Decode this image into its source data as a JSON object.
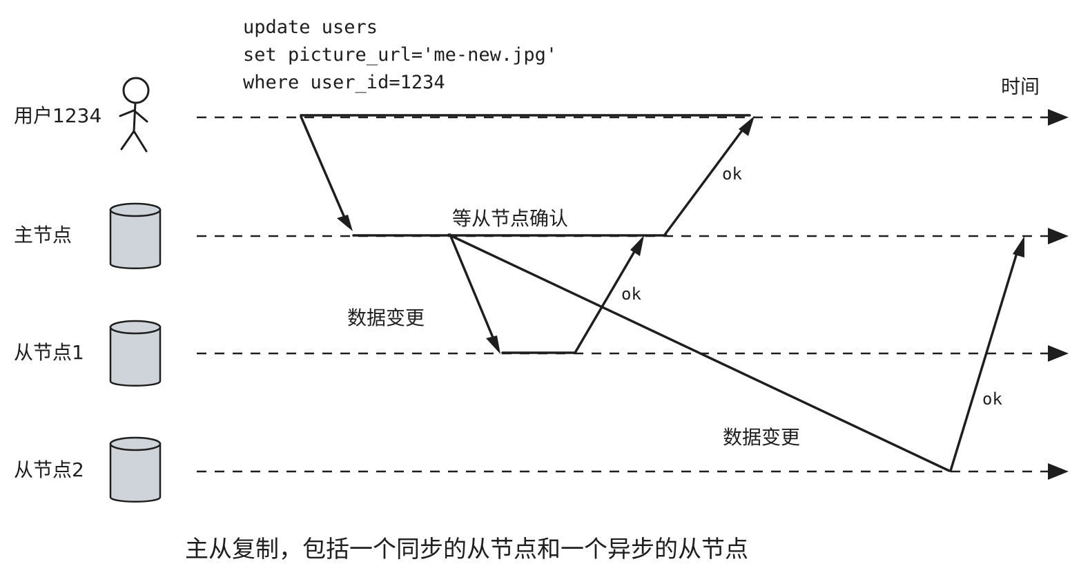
{
  "diagram": {
    "lanes": [
      {
        "id": "user",
        "label": "用户1234",
        "icon": "stick-figure-icon"
      },
      {
        "id": "primary",
        "label": "主节点",
        "icon": "database-cylinder-icon"
      },
      {
        "id": "follower1",
        "label": "从节点1",
        "icon": "database-cylinder-icon"
      },
      {
        "id": "follower2",
        "label": "从节点2",
        "icon": "database-cylinder-icon"
      }
    ],
    "time_label": "时间",
    "sql": {
      "line1": "update users",
      "line2": "set picture_url='me-new.jpg'",
      "line3": "where user_id=1234"
    },
    "wait_label": "等从节点确认",
    "change_label_1": "数据变更",
    "change_label_2": "数据变更",
    "ok_user": "ok",
    "ok_follower1": "ok",
    "ok_follower2": "ok",
    "caption": "主从复制，包括一个同步的从节点和一个异步的从节点",
    "colors": {
      "stroke": "#1e1e1e",
      "cylinder_fill": "#ced4da",
      "background": "#ffffff"
    }
  }
}
